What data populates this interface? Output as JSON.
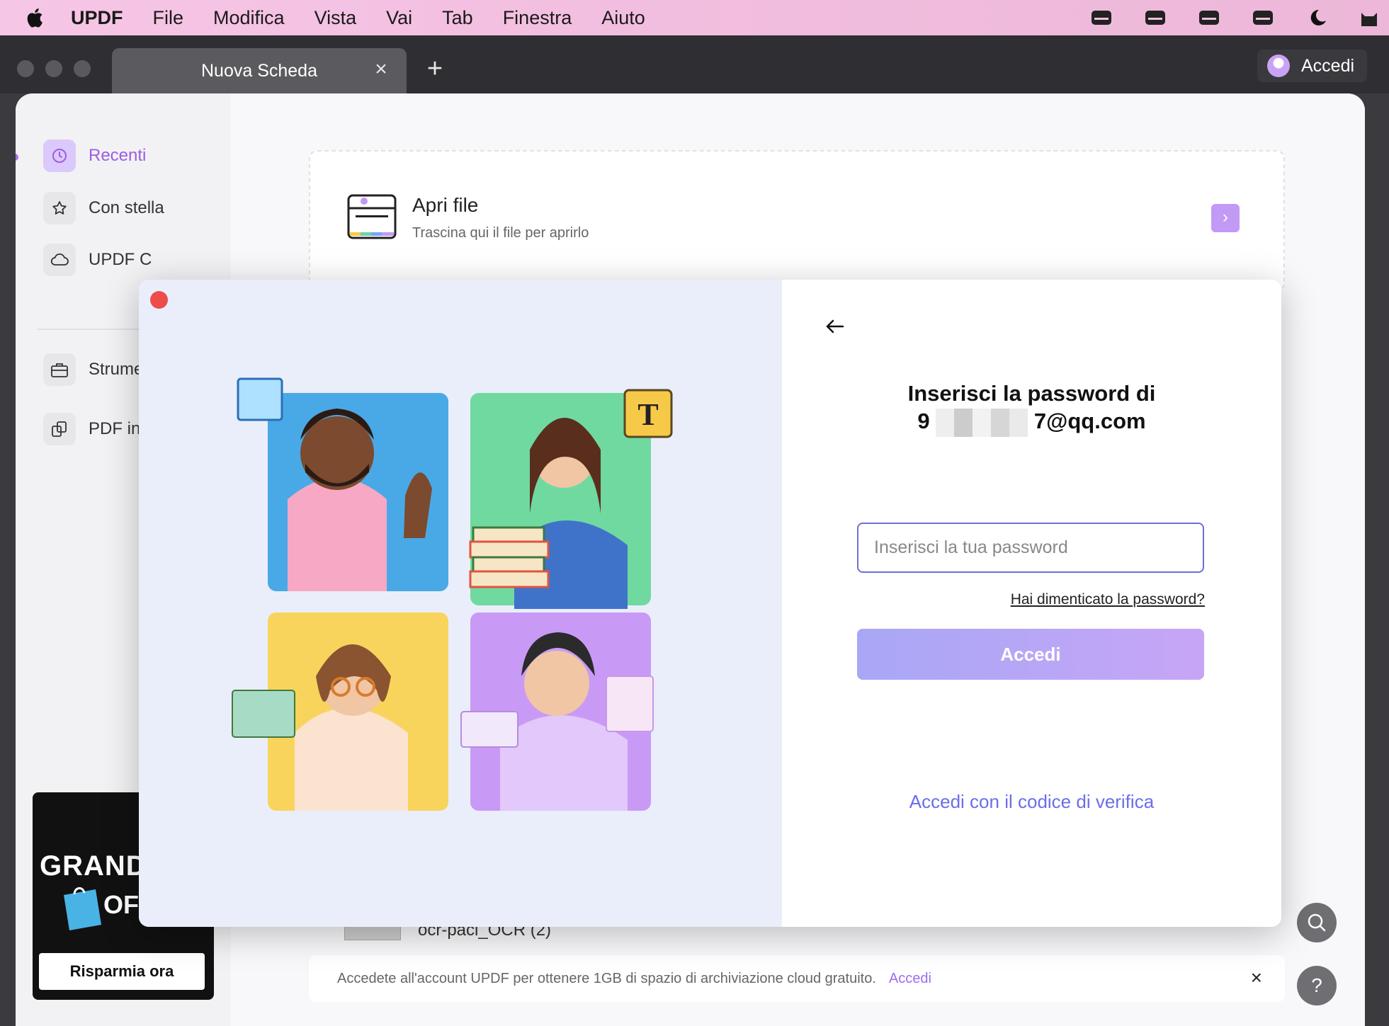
{
  "menubar": {
    "app_name": "UPDF",
    "items": [
      "File",
      "Modifica",
      "Vista",
      "Vai",
      "Tab",
      "Finestra",
      "Aiuto"
    ]
  },
  "tabs": {
    "active_label": "Nuova Scheda",
    "close_symbol": "×",
    "new_tab_symbol": "+"
  },
  "header": {
    "login_label": "Accedi"
  },
  "sidebar": {
    "items": [
      {
        "label": "Recenti",
        "icon": "clock-icon"
      },
      {
        "label": "Con stella",
        "icon": "star-icon"
      },
      {
        "label": "UPDF C",
        "icon": "cloud-icon"
      },
      {
        "label": "Strume",
        "icon": "toolbox-icon"
      },
      {
        "label": "PDF in",
        "icon": "pages-icon"
      }
    ]
  },
  "open_file": {
    "title": "Apri file",
    "subtitle": "Trascina qui il file per aprirlo",
    "arrow": "›"
  },
  "recent_file": {
    "name": "ocr-paci_OCR (2)"
  },
  "promo_bar": {
    "text": "Accedete all'account UPDF per ottenere 1GB di spazio di archiviazione cloud gratuito.",
    "link": "Accedi",
    "close": "×"
  },
  "ad": {
    "line1": "GRANDE",
    "line2": "OF",
    "button": "Risparmia ora"
  },
  "fab": {
    "search": "search-icon",
    "help": "?"
  },
  "modal": {
    "heading_line1": "Inserisci la password di",
    "email_prefix": "9",
    "email_suffix": "7@qq.com",
    "password_placeholder": "Inserisci la tua password",
    "forgot_link": "Hai dimenticato la password?",
    "submit_label": "Accedi",
    "alt_login_link": "Accedi con il codice di verifica"
  },
  "colors": {
    "accent": "#9d6df2",
    "menubar": "#f3bfe0",
    "close_dot": "#ee4b4b",
    "submit_gradient_start": "#a8a7f6",
    "submit_gradient_end": "#c7a5f6"
  }
}
